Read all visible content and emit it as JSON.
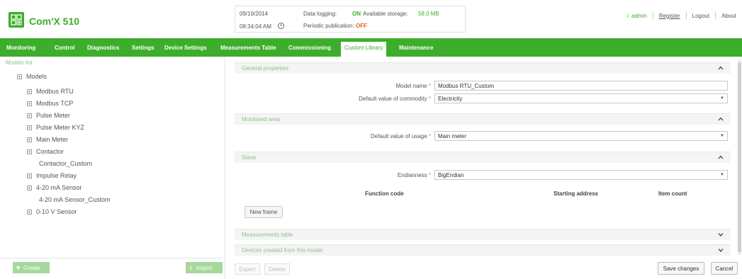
{
  "header": {
    "product_name": "Com'X 510",
    "logo_icon": "building-grid-icon",
    "status": {
      "date": "09/19/2014",
      "time": "08:34:04 AM",
      "data_logging_label": "Data logging:",
      "data_logging_value": "ON",
      "storage_label": "Available storage:",
      "storage_value": "58.0 MB",
      "publication_label": "Periodic publication:",
      "publication_value": "OFF"
    },
    "links": {
      "user": "admin",
      "register": "Register",
      "logout": "Logout",
      "about": "About"
    }
  },
  "nav": {
    "items": [
      "Monitoring",
      "Control",
      "Diagnostics",
      "Settings",
      "Device Settings",
      "Measurements Table",
      "Commissioning",
      "Custom Library",
      "Maintenance"
    ],
    "active": "Custom Library"
  },
  "left": {
    "list_label": "Models list",
    "tree": {
      "root": "Models",
      "modbus_rtu": "Modbus RTU",
      "modbus_tcp": "Modbus TCP",
      "pulse_meter": "Pulse Meter",
      "pulse_meter_kyz": "Pulse Meter KYZ",
      "main_meter": "Main Meter",
      "contactor": "Contactor",
      "contactor_custom": "Contactor_Custom",
      "impulse_relay": "Impulse Relay",
      "sensor_4_20": "4-20 mA Sensor",
      "sensor_4_20_custom": "4-20 mA Sensor_Custom",
      "sensor_0_10": "0-10 V Sensor"
    },
    "create_label": "Create",
    "import_label": "Import"
  },
  "main": {
    "general": {
      "title": "General properties",
      "model_name_label": "Model name",
      "model_name_value": "Modbus RTU_Custom",
      "commodity_label": "Default value of commodity",
      "commodity_value": "Electricity"
    },
    "monitored": {
      "title": "Monitored area",
      "usage_label": "Default value of usage",
      "usage_value": "Main meter"
    },
    "slave": {
      "title": "Slave",
      "endianness_label": "Endianness",
      "endianness_value": "BigEndian",
      "col_function_code": "Function code",
      "col_starting_address": "Starting address",
      "col_item_count": "Item count",
      "new_frame_label": "New frame"
    },
    "measurements_title": "Measurements table",
    "devices_title": "Devices created from this model",
    "required_mark": "*"
  },
  "footer": {
    "export_label": "Export",
    "delete_label": "Delete",
    "save_label": "Save changes",
    "cancel_label": "Cancel"
  },
  "colors": {
    "brand_green": "#3dae2b",
    "pale_green": "#a6d89c",
    "off_orange": "#e8601c"
  }
}
